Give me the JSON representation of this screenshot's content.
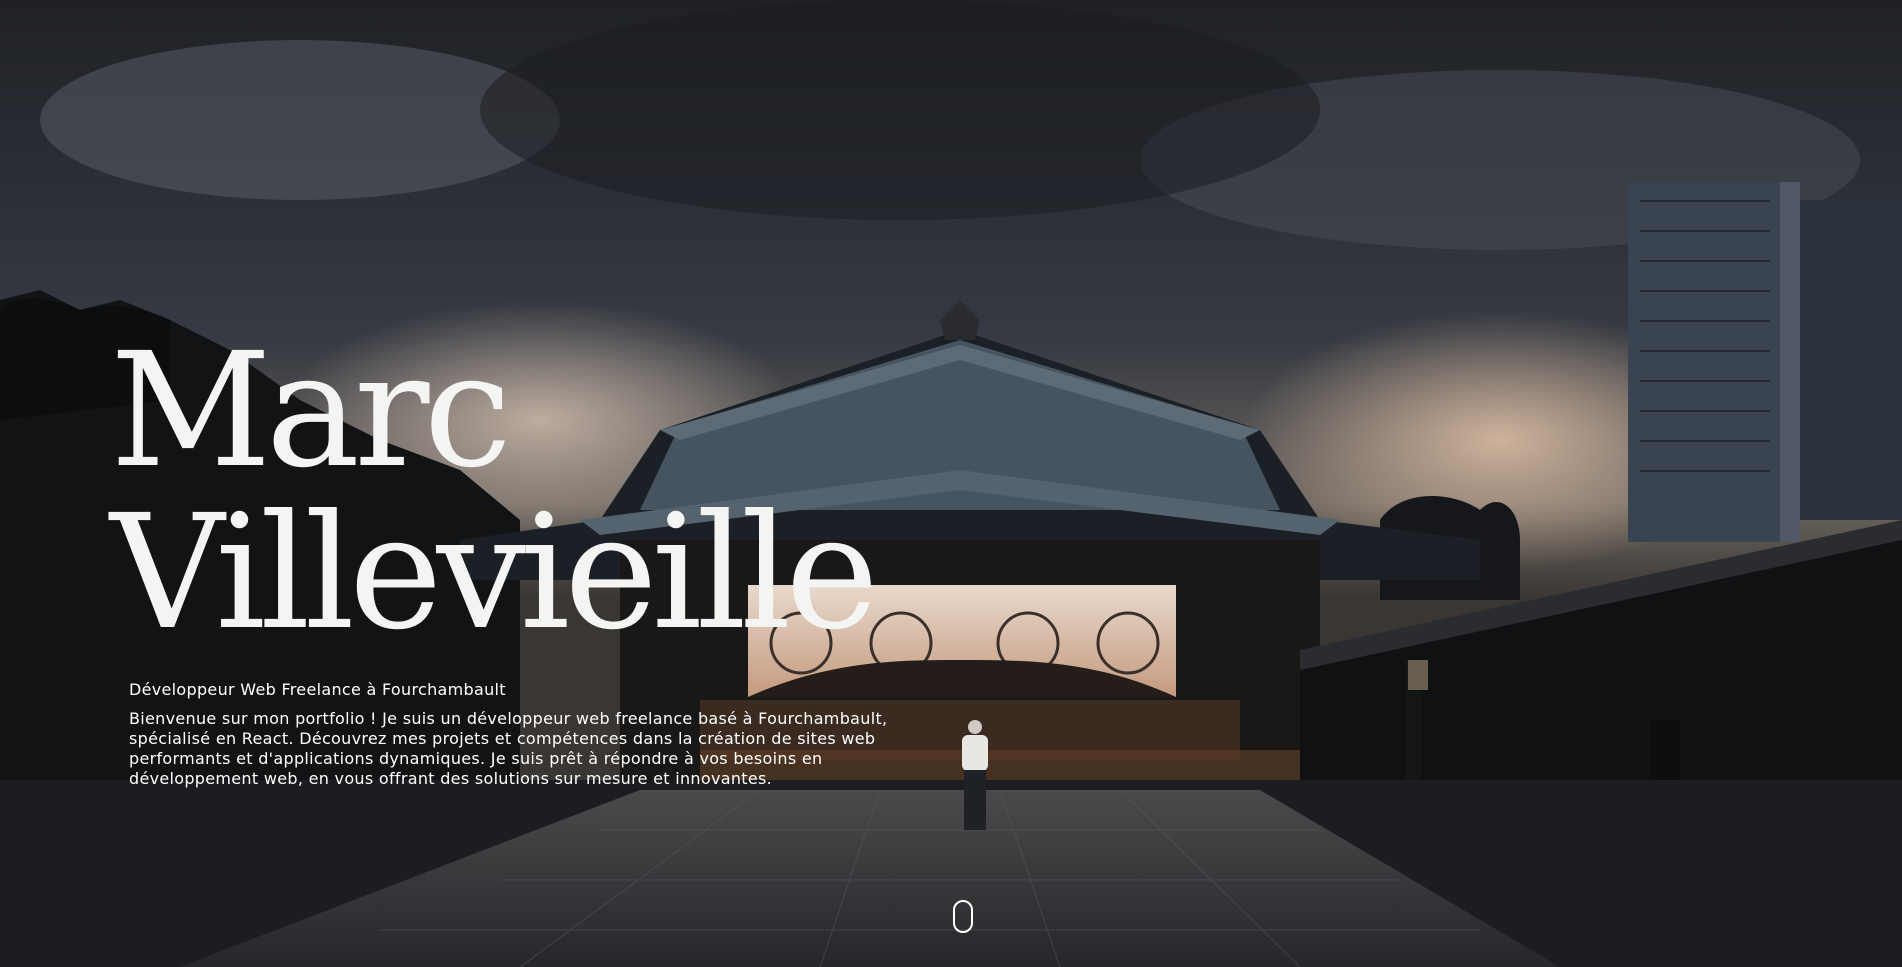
{
  "hero": {
    "name_line1": "Marc",
    "name_line2": "Villevieille",
    "subtitle": "Développeur Web Freelance à Fourchambault",
    "intro": "Bienvenue sur mon portfolio ! Je suis un développeur web freelance basé à Fourchambault, spécialisé en React. Découvrez mes projets et compétences dans la création de sites web performants et d'applications dynamiques. Je suis prêt à répondre à vos besoins en développement web, en vous offrant des solutions sur mesure et innovantes."
  },
  "scroll_indicator": {
    "icon": "mouse-scroll-icon"
  },
  "colors": {
    "text": "#ffffff",
    "sky": "#2a2d33",
    "glow": "#d9b39a"
  }
}
